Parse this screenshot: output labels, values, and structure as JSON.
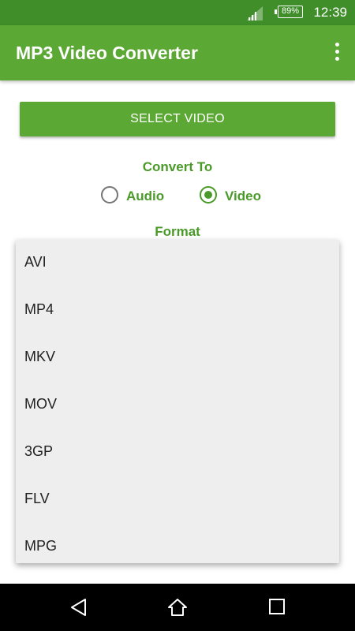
{
  "status_bar": {
    "battery": "89%",
    "time": "12:39",
    "icons": [
      "signal-icon",
      "battery-icon"
    ]
  },
  "app_bar": {
    "title": "MP3 Video Converter",
    "overflow_icon": "more-vert-icon"
  },
  "main": {
    "select_video_label": "SELECT VIDEO",
    "convert_to_label": "Convert To",
    "radio_options": [
      {
        "label": "Audio",
        "checked": false
      },
      {
        "label": "Video",
        "checked": true
      }
    ],
    "format_label": "Format"
  },
  "format_dropdown": {
    "options": [
      "AVI",
      "MP4",
      "MKV",
      "MOV",
      "3GP",
      "FLV",
      "MPG"
    ]
  },
  "nav_bar": {
    "icons": [
      "back-icon",
      "home-icon",
      "recents-icon"
    ]
  },
  "colors": {
    "status_bar": "#3f8e2a",
    "primary": "#5ca834",
    "accent_text": "#4a9a2a",
    "dropdown_bg": "#eeeeee"
  }
}
